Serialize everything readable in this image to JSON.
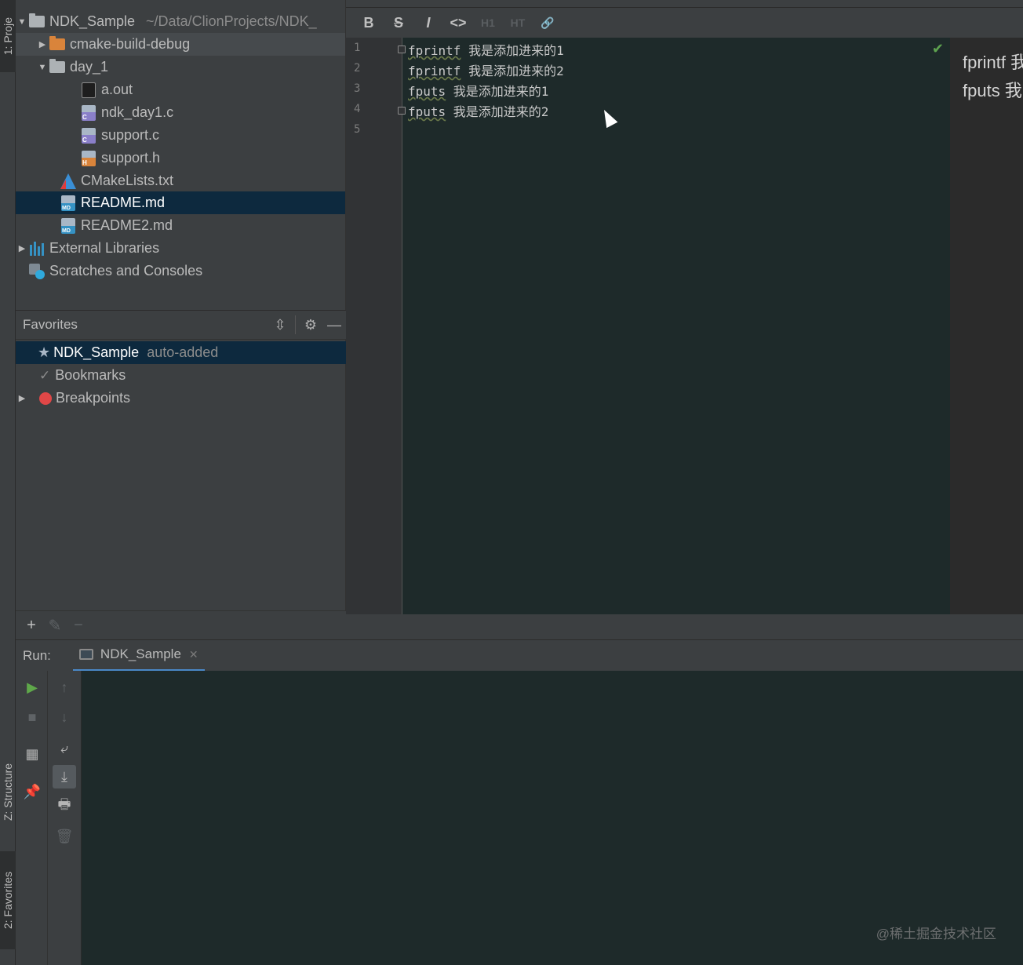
{
  "tool_windows": {
    "project_tab": "1: Proje",
    "structure_tab": "Z: Structure",
    "favorites_tab": "2: Favorites"
  },
  "project_tree": {
    "root": {
      "name": "NDK_Sample",
      "path": "~/Data/ClionProjects/NDK_"
    },
    "items": [
      {
        "label": "cmake-build-debug",
        "type": "folder-orange"
      },
      {
        "label": "day_1",
        "type": "folder"
      },
      {
        "label": "a.out",
        "type": "exe"
      },
      {
        "label": "ndk_day1.c",
        "type": "c"
      },
      {
        "label": "support.c",
        "type": "c"
      },
      {
        "label": "support.h",
        "type": "h"
      },
      {
        "label": "CMakeLists.txt",
        "type": "cmake"
      },
      {
        "label": "README.md",
        "type": "md"
      },
      {
        "label": "README2.md",
        "type": "md"
      },
      {
        "label": "External Libraries",
        "type": "lib"
      },
      {
        "label": "Scratches and Consoles",
        "type": "scratch"
      }
    ]
  },
  "favorites": {
    "title": "Favorites",
    "items": [
      {
        "label": "NDK_Sample",
        "note": "auto-added"
      },
      {
        "label": "Bookmarks"
      },
      {
        "label": "Breakpoints"
      }
    ]
  },
  "markdown_toolbar": {
    "bold": "B",
    "strike": "S",
    "italic": "I",
    "code": "<>",
    "h1": "H1",
    "ht": "HT"
  },
  "editor": {
    "line_numbers": [
      "1",
      "2",
      "3",
      "4",
      "5"
    ],
    "lines": [
      {
        "kw": "fprintf",
        "text": " 我是添加进来的1"
      },
      {
        "kw": "fprintf",
        "text": " 我是添加进来的2"
      },
      {
        "kw": "fputs",
        "text": " 我是添加进来的1"
      },
      {
        "kw": "fputs",
        "text": " 我是添加进来的2"
      }
    ]
  },
  "preview": {
    "lines": [
      "fprintf 我",
      "fputs 我"
    ]
  },
  "run": {
    "label": "Run:",
    "tab": "NDK_Sample"
  },
  "watermark": "@稀土掘金技术社区",
  "colors": {
    "selection": "#0d293e",
    "panel": "#3c3f41",
    "editor_bg": "#1e2a2a",
    "run_tab_underline": "#4a88c7",
    "breakpoint": "#e04747"
  }
}
